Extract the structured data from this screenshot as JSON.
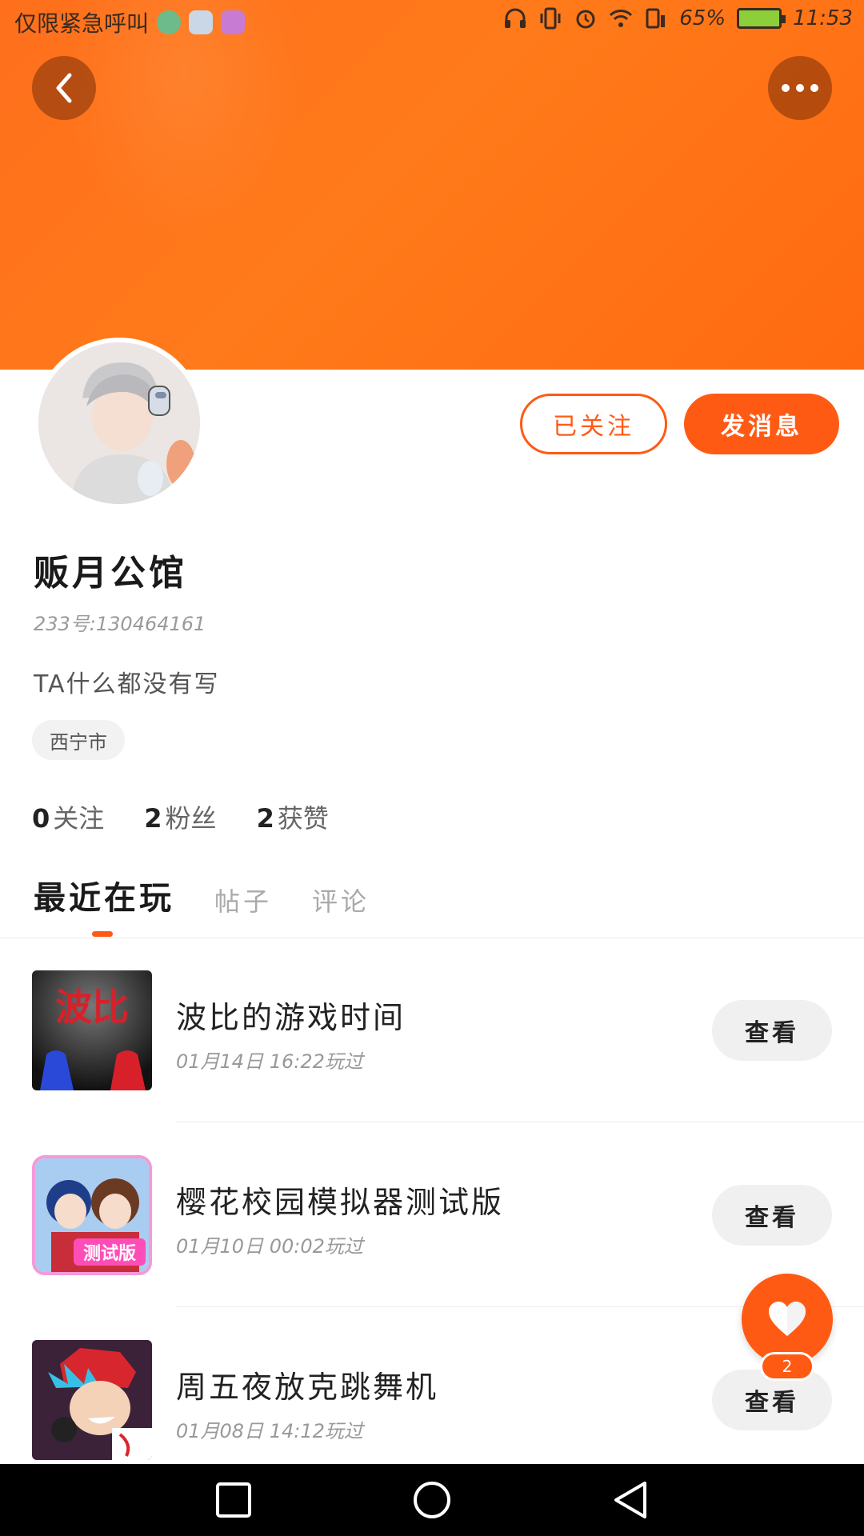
{
  "status_bar": {
    "left_text": "仅限紧急呼叫",
    "battery": "65%",
    "time": "11:53"
  },
  "profile": {
    "follow_button": "已关注",
    "message_button": "发消息",
    "username": "贩月公馆",
    "user_id": "233号:130464161",
    "bio": "TA什么都没有写",
    "location": "西宁市",
    "stats": [
      {
        "num": "0",
        "label": "关注"
      },
      {
        "num": "2",
        "label": "粉丝"
      },
      {
        "num": "2",
        "label": "获赞"
      }
    ]
  },
  "tabs": [
    "最近在玩",
    "帖子",
    "评论"
  ],
  "games": [
    {
      "title": "波比的游戏时间",
      "time": "01月14日 16:22玩过",
      "button": "查看",
      "thumb_text": "波比"
    },
    {
      "title": "樱花校园模拟器测试版",
      "time": "01月10日 00:02玩过",
      "button": "查看",
      "thumb_text": "测试版"
    },
    {
      "title": "周五夜放克跳舞机",
      "time": "01月08日 14:12玩过",
      "button": "查看"
    }
  ],
  "fab": {
    "badge": "2"
  },
  "colors": {
    "accent": "#ff5a14",
    "header": "#ff7a1a"
  }
}
